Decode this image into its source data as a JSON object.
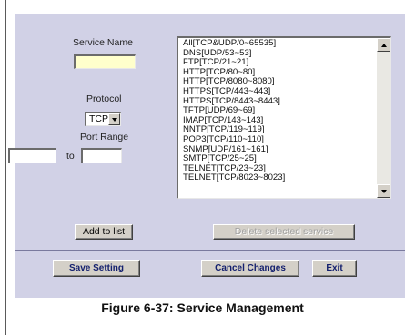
{
  "form": {
    "service_name_label": "Service Name",
    "service_name_value": "",
    "protocol_label": "Protocol",
    "protocol_selected": "TCP",
    "port_range_label": "Port Range",
    "port_from": "",
    "port_to_separator": "to",
    "port_to": ""
  },
  "services": [
    "All[TCP&UDP/0~65535]",
    "DNS[UDP/53~53]",
    "FTP[TCP/21~21]",
    "HTTP[TCP/80~80]",
    "HTTP[TCP/8080~8080]",
    "HTTPS[TCP/443~443]",
    "HTTPS[TCP/8443~8443]",
    "TFTP[UDP/69~69]",
    "IMAP[TCP/143~143]",
    "NNTP[TCP/119~119]",
    "POP3[TCP/110~110]",
    "SNMP[UDP/161~161]",
    "SMTP[TCP/25~25]",
    "TELNET[TCP/23~23]",
    "TELNET[TCP/8023~8023]"
  ],
  "buttons": {
    "add_to_list": "Add to list",
    "delete_selected": "Delete selected service",
    "save_setting": "Save Setting",
    "cancel_changes": "Cancel Changes",
    "exit": "Exit"
  },
  "caption": "Figure 6-37: Service Management"
}
